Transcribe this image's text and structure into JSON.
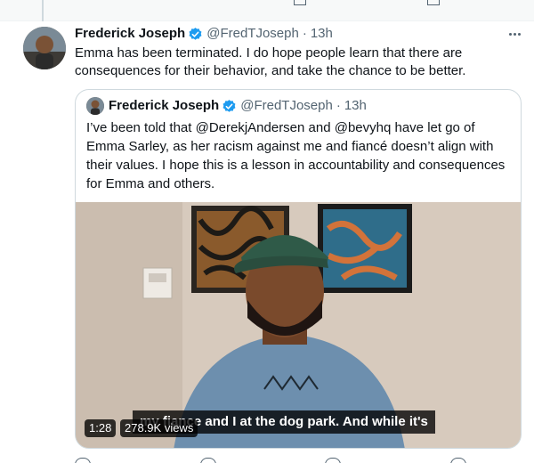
{
  "tweet": {
    "author_name": "Frederick Joseph",
    "author_handle": "@FredTJoseph",
    "dot": "·",
    "time": "13h",
    "text": "Emma has been terminated. I do hope people learn that there are consequences for their behavior, and take the chance to be better.",
    "icons": {
      "verified": "verified-badge-icon",
      "more": "more-options-icon"
    },
    "colors": {
      "verified": "#1d9bf0",
      "secondary_text": "#536471",
      "primary_text": "#0f1419",
      "border": "#cfd9de"
    }
  },
  "quote": {
    "author_name": "Frederick Joseph",
    "author_handle": "@FredTJoseph",
    "dot": "·",
    "time": "13h",
    "text": "I’ve been told that @DerekjAndersen and @bevyhq have let go of Emma Sarley, as her racism against me and fiancé doesn’t align with their values. I hope this is a lesson in accountability and consequences for Emma and others.",
    "video": {
      "duration": "1:28",
      "views": "278.9K views",
      "caption": "my fiance and I at the dog park. And while it's"
    }
  }
}
